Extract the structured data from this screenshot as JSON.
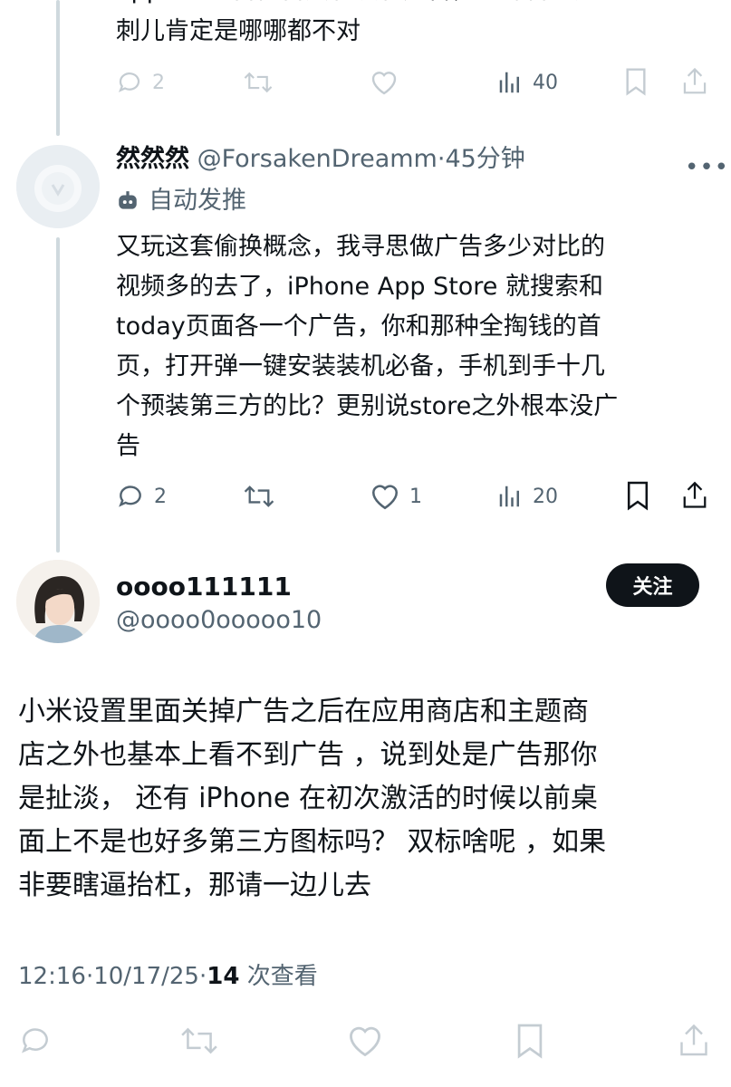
{
  "prev_reply": {
    "partial_line_top": "appstore 百宫百页有没有广告，一部智能见去挑",
    "partial_line": "刺儿肯定是哪哪都不对",
    "actions": {
      "replies": "2",
      "retweets": "",
      "likes": "",
      "views": "40"
    }
  },
  "reply": {
    "display_name": "然然然",
    "handle": "@ForsakenDreamm",
    "time": "45分钟",
    "bot_label": "自动发推",
    "text_lines": [
      "又玩这套偷换概念，我寻思做广告多少对比的",
      "视频多的去了，iPhone App Store 就搜索和",
      "today页面各一个广告，你和那种全掏钱的首",
      "页，打开弹一键安装装机必备，手机到手十几",
      "个预装第三方的比？更别说store之外根本没广",
      "告"
    ],
    "actions": {
      "replies": "2",
      "retweets": "",
      "likes": "1",
      "views": "20"
    }
  },
  "main_post": {
    "display_name": "oooo111111",
    "handle": "@oooo0ooooo10",
    "follow_label": "关注",
    "text_lines": [
      "小米设置里面关掉广告之后在应用商店和主题商",
      "店之外也基本上看不到广告 ，说到处是广告那你",
      "是扯淡，  还有 iPhone 在初次激活的时候以前桌",
      "面上不是也好多第三方图标吗？ 双标啥呢 ，如果",
      "非要瞎逼抬杠，那请一边儿去"
    ],
    "meta": {
      "time": "12:16",
      "date": "10/17/25",
      "views": "14",
      "views_label": "次查看"
    }
  },
  "colors": {
    "text": "#0f1419",
    "secondary": "#536471",
    "faded": "#c4ccd2",
    "thread_line": "#cfd9de",
    "button_bg": "#0f1419"
  }
}
